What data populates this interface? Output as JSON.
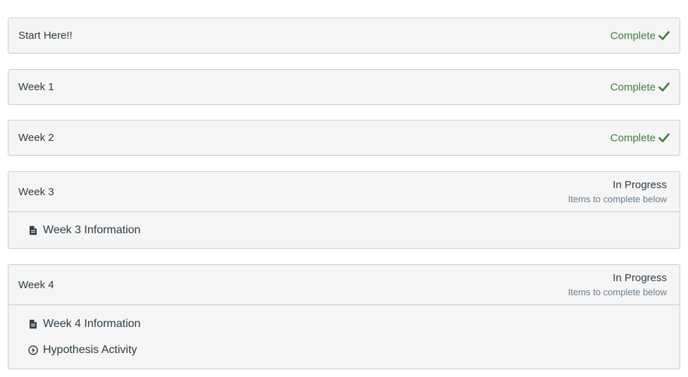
{
  "modules": [
    {
      "title": "Start Here!!",
      "status": "Complete"
    },
    {
      "title": "Week 1",
      "status": "Complete"
    },
    {
      "title": "Week 2",
      "status": "Complete"
    },
    {
      "title": "Week 3",
      "status": "In Progress",
      "status_note": "Items to complete below",
      "items": [
        {
          "label": "Week 3 Information",
          "icon": "document-icon"
        }
      ]
    },
    {
      "title": "Week 4",
      "status": "In Progress",
      "status_note": "Items to complete below",
      "items": [
        {
          "label": "Week 4 Information",
          "icon": "document-icon"
        },
        {
          "label": "Hypothesis Activity",
          "icon": "lightning-circle-icon"
        }
      ]
    }
  ],
  "colors": {
    "complete": "#3f7c3a",
    "panel_bg": "#f5f5f5",
    "border": "#c7cdd1",
    "note": "#6b7d8e"
  }
}
